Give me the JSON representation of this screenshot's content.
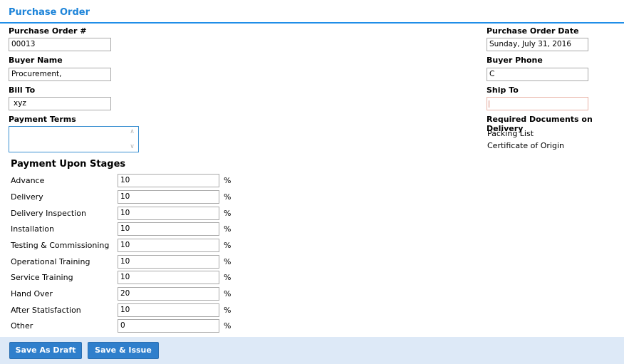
{
  "header": {
    "title": "Purchase Order"
  },
  "form": {
    "po_number_label": "Purchase Order #",
    "po_number_value": "00013",
    "buyer_name_label": "Buyer Name",
    "buyer_name_value": "Procurement,",
    "bill_to_label": "Bill To",
    "bill_to_value": "xyz",
    "payment_terms_label": "Payment Terms",
    "payment_terms_value": "",
    "po_date_label": "Purchase Order Date",
    "po_date_value": "Sunday, July 31, 2016",
    "buyer_phone_label": "Buyer Phone",
    "buyer_phone_value": "C",
    "ship_to_label": "Ship To",
    "ship_to_value": "",
    "required_docs_label": "Required Documents on Delivery",
    "required_docs": [
      "Packing List",
      "Certificate of Origin"
    ]
  },
  "stages": {
    "title": "Payment Upon Stages",
    "unit": "%",
    "rows": [
      {
        "label": "Advance",
        "value": "10"
      },
      {
        "label": "Delivery",
        "value": "10"
      },
      {
        "label": "Delivery Inspection",
        "value": "10"
      },
      {
        "label": "Installation",
        "value": "10"
      },
      {
        "label": "Testing & Commissioning",
        "value": "10"
      },
      {
        "label": "Operational Training",
        "value": "10"
      },
      {
        "label": "Service Training",
        "value": "10"
      },
      {
        "label": "Hand Over",
        "value": "20"
      },
      {
        "label": "After Statisfaction",
        "value": "10"
      },
      {
        "label": "Other",
        "value": "0"
      }
    ]
  },
  "actions": {
    "save_draft_label": "Save As Draft",
    "save_issue_label": "Save & Issue"
  },
  "colors": {
    "accent": "#1f8ee8",
    "title": "#1d84d9",
    "button": "#2f7fcc",
    "footer_bg": "#dde9f7"
  }
}
